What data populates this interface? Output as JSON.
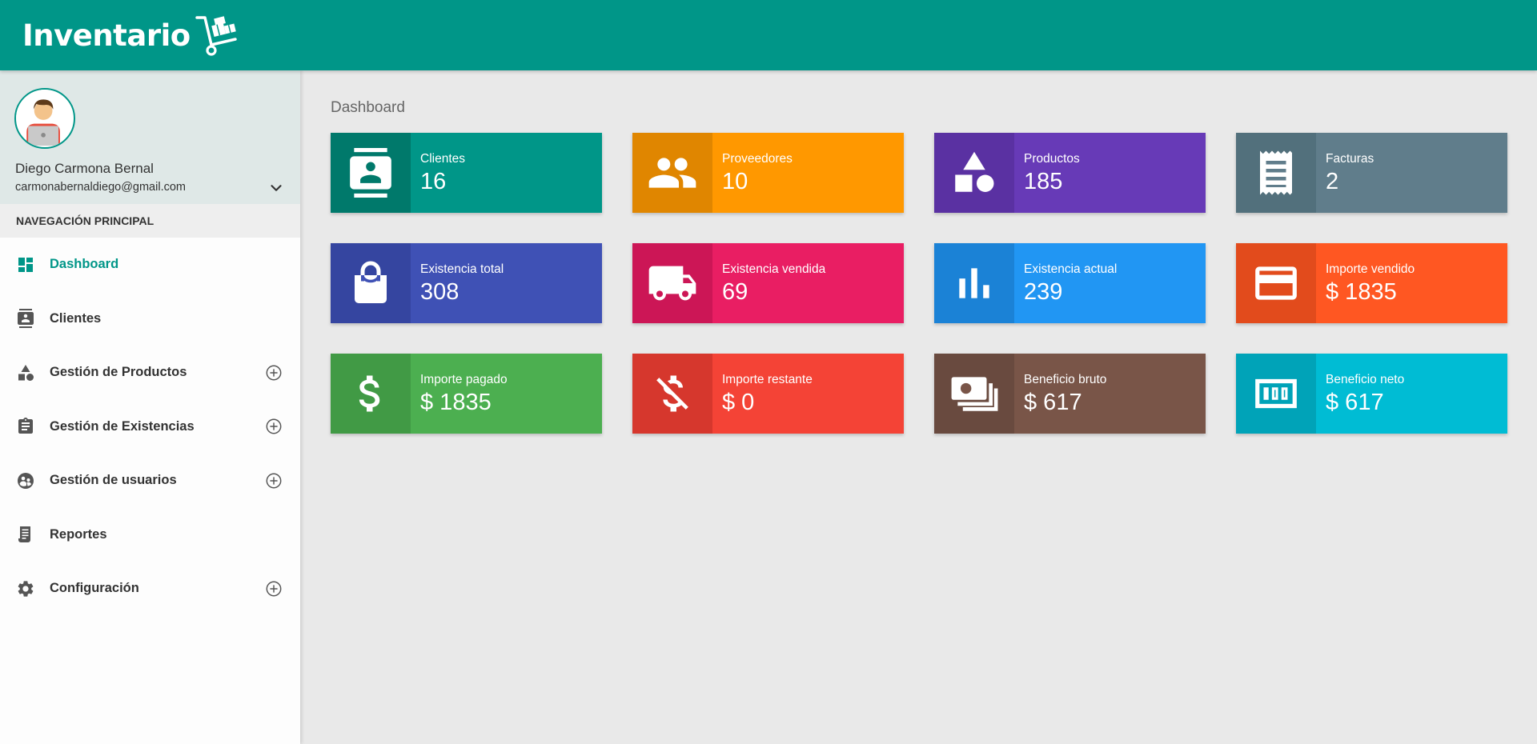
{
  "brand": {
    "name": "Inventario"
  },
  "colors": {
    "primary": "#009688",
    "sidebar_user_bg": "#dfe8e7",
    "content_bg": "#e9e9e9"
  },
  "user": {
    "name": "Diego Carmona Bernal",
    "email": "carmonabernaldiego@gmail.com",
    "toggle_icon": "chevron-down-icon"
  },
  "nav": {
    "header": "NAVEGACIÓN PRINCIPAL",
    "items": [
      {
        "label": "Dashboard",
        "icon": "dashboard-icon",
        "active": true,
        "expandable": false
      },
      {
        "label": "Clientes",
        "icon": "contacts-icon",
        "active": false,
        "expandable": false
      },
      {
        "label": "Gestión de Productos",
        "icon": "category-icon",
        "active": false,
        "expandable": true
      },
      {
        "label": "Gestión de Existencias",
        "icon": "clipboard-icon",
        "active": false,
        "expandable": true
      },
      {
        "label": "Gestión de usuarios",
        "icon": "users-globe-icon",
        "active": false,
        "expandable": true
      },
      {
        "label": "Reportes",
        "icon": "receipt-icon",
        "active": false,
        "expandable": false
      },
      {
        "label": "Configuración",
        "icon": "gear-icon",
        "active": false,
        "expandable": true
      }
    ]
  },
  "page": {
    "title": "Dashboard"
  },
  "cards": [
    {
      "title": "Clientes",
      "value": "16",
      "icon": "contact-card-icon",
      "color": "#009688",
      "icon_bg": "#00796b"
    },
    {
      "title": "Proveedores",
      "value": "10",
      "icon": "people-icon",
      "color": "#ff9800",
      "icon_bg": "#e08600"
    },
    {
      "title": "Productos",
      "value": "185",
      "icon": "shapes-icon",
      "color": "#673ab7",
      "icon_bg": "#5a31a2"
    },
    {
      "title": "Facturas",
      "value": "2",
      "icon": "receipt-icon",
      "color": "#607d8b",
      "icon_bg": "#52707c"
    },
    {
      "title": "Existencia total",
      "value": "308",
      "icon": "shopping-bag-icon",
      "color": "#3f51b5",
      "icon_bg": "#3545a0"
    },
    {
      "title": "Existencia vendida",
      "value": "69",
      "icon": "truck-icon",
      "color": "#e91e63",
      "icon_bg": "#cc1656"
    },
    {
      "title": "Existencia actual",
      "value": "239",
      "icon": "bar-chart-icon",
      "color": "#2196f3",
      "icon_bg": "#1b82d6"
    },
    {
      "title": "Importe vendido",
      "value": "$ 1835",
      "icon": "credit-card-icon",
      "color": "#ff5722",
      "icon_bg": "#e24b1c"
    },
    {
      "title": "Importe pagado",
      "value": "$ 1835",
      "icon": "dollar-icon",
      "color": "#4caf50",
      "icon_bg": "#419a45"
    },
    {
      "title": "Importe restante",
      "value": "$ 0",
      "icon": "money-off-icon",
      "color": "#f44336",
      "icon_bg": "#d6372d"
    },
    {
      "title": "Beneficio bruto",
      "value": "$ 617",
      "icon": "money-stack-icon",
      "color": "#795548",
      "icon_bg": "#694a3f"
    },
    {
      "title": "Beneficio neto",
      "value": "$ 617",
      "icon": "money-bill-icon",
      "color": "#00bcd4",
      "icon_bg": "#00a3b8"
    }
  ]
}
